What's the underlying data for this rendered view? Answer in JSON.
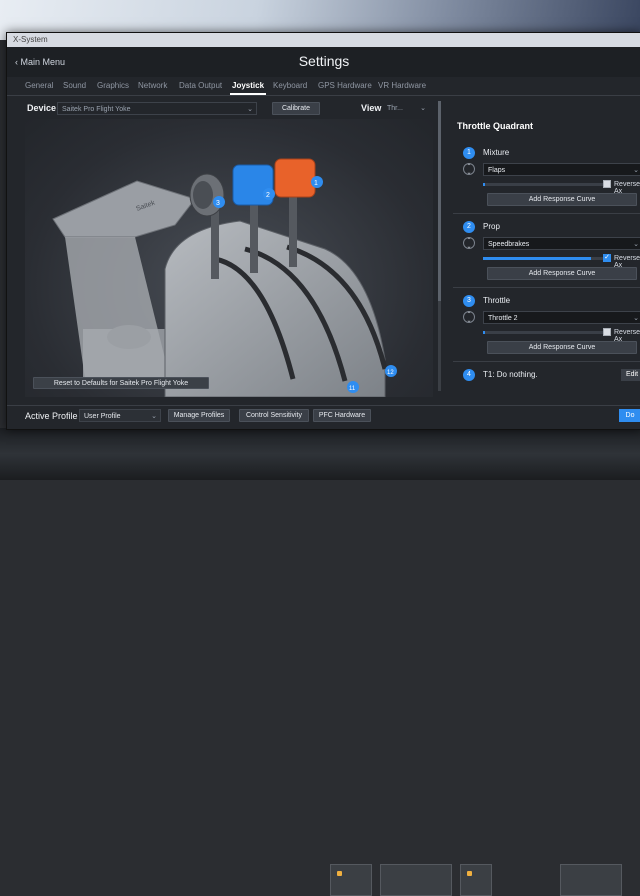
{
  "window": {
    "title": "X-System",
    "page_title": "Settings",
    "back_label": "Main Menu"
  },
  "tabs": [
    "General",
    "Sound",
    "Graphics",
    "Network",
    "Data Output",
    "Joystick",
    "Keyboard",
    "GPS Hardware",
    "VR Hardware"
  ],
  "active_tab": "Joystick",
  "device": {
    "label": "Device",
    "value": "Saitek Pro Flight Yoke",
    "calibrate": "Calibrate"
  },
  "view": {
    "label": "View",
    "value": "Thr..."
  },
  "viewport": {
    "reset_button": "Reset to Defaults for Saitek Pro Flight Yoke",
    "brand": "Saitek",
    "lever_numbers": [
      "3",
      "2",
      "1"
    ],
    "detent_markers": [
      "11",
      "12"
    ]
  },
  "quadrant": {
    "title": "Throttle Quadrant",
    "axes": [
      {
        "num": "1",
        "name": "Mixture",
        "assignment": "Flaps",
        "level": 0.02,
        "reverse_label": "Reverse Ax",
        "reverse": false,
        "curve_button": "Add Response Curve"
      },
      {
        "num": "2",
        "name": "Prop",
        "assignment": "Speedbrakes",
        "level": 0.9,
        "reverse_label": "Reverse Ax",
        "reverse": true,
        "curve_button": "Add Response Curve"
      },
      {
        "num": "3",
        "name": "Throttle",
        "assignment": "Throttle 2",
        "level": 0.02,
        "reverse_label": "Reverse Ax",
        "reverse": false,
        "curve_button": "Add Response Curve"
      }
    ],
    "buttons": [
      {
        "num": "4",
        "text": "T1: Do nothing.",
        "edit": "Edit"
      }
    ]
  },
  "bottom": {
    "profile_label": "Active Profile",
    "profile_value": "User Profile",
    "manage": "Manage Profiles",
    "sensitivity": "Control Sensitivity",
    "pfc": "PFC Hardware",
    "done": "Do"
  },
  "colors": {
    "accent": "#2f8df0",
    "lever_blue": "#2a86e8",
    "lever_orange": "#e8622a"
  }
}
